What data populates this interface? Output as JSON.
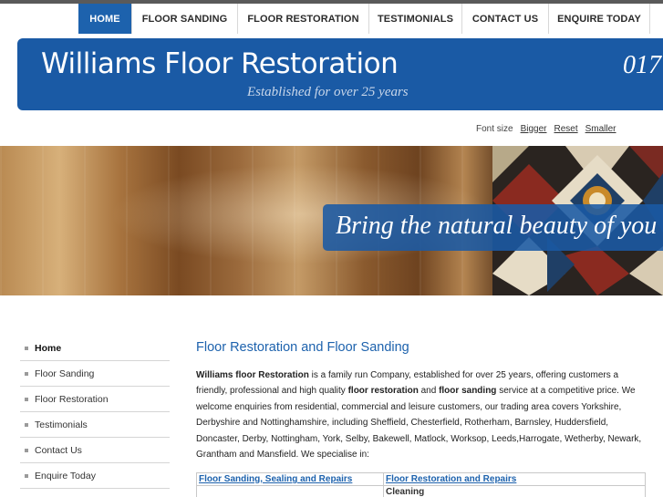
{
  "nav": {
    "items": [
      {
        "label": "HOME",
        "active": true
      },
      {
        "label": "FLOOR SANDING",
        "active": false
      },
      {
        "label": "FLOOR RESTORATION",
        "active": false
      },
      {
        "label": "TESTIMONIALS",
        "active": false
      },
      {
        "label": "CONTACT US",
        "active": false
      },
      {
        "label": "ENQUIRE TODAY",
        "active": false
      }
    ]
  },
  "header": {
    "brand": "Williams Floor Restoration",
    "tagline": "Established for over 25 years",
    "phone": "017"
  },
  "font_controls": {
    "label": "Font size",
    "bigger": "Bigger",
    "reset": "Reset",
    "smaller": "Smaller"
  },
  "hero": {
    "caption": "Bring the natural beauty of you"
  },
  "sidebar": {
    "items": [
      {
        "label": "Home",
        "active": true
      },
      {
        "label": "Floor Sanding",
        "active": false
      },
      {
        "label": "Floor Restoration",
        "active": false
      },
      {
        "label": "Testimonials",
        "active": false
      },
      {
        "label": "Contact Us",
        "active": false
      },
      {
        "label": "Enquire Today",
        "active": false
      }
    ]
  },
  "main": {
    "heading": "Floor Restoration and Floor Sanding",
    "intro": {
      "company": "Williams floor Restoration",
      "part1": " is a family run Company, established for over 25 years, offering customers a friendly, professional and high quality ",
      "b1": "floor restoration",
      "and": " and ",
      "b2": "floor sanding",
      "part2": " service at a competitive price. We welcome enquiries from residential, commercial and leisure customers, our trading area covers Yorkshire, Derbyshire and Nottinghamshire, including Sheffield, Chesterfield, Rotherham, Barnsley, Huddersfield, Doncaster, Derby, Nottingham, York, Selby, Bakewell, Matlock, Worksop, Leeds,Harrogate, Wetherby, Newark, Grantham and Mansfield. We specialise in:"
    },
    "services": [
      {
        "left": "Floor Sanding, Sealing and Repairs",
        "right": "Floor Restoration and Repairs"
      },
      {
        "left": "",
        "right": "Cleaning"
      }
    ]
  },
  "colors": {
    "brand_blue": "#1d62ad",
    "banner_blue": "#1a5aa5"
  }
}
